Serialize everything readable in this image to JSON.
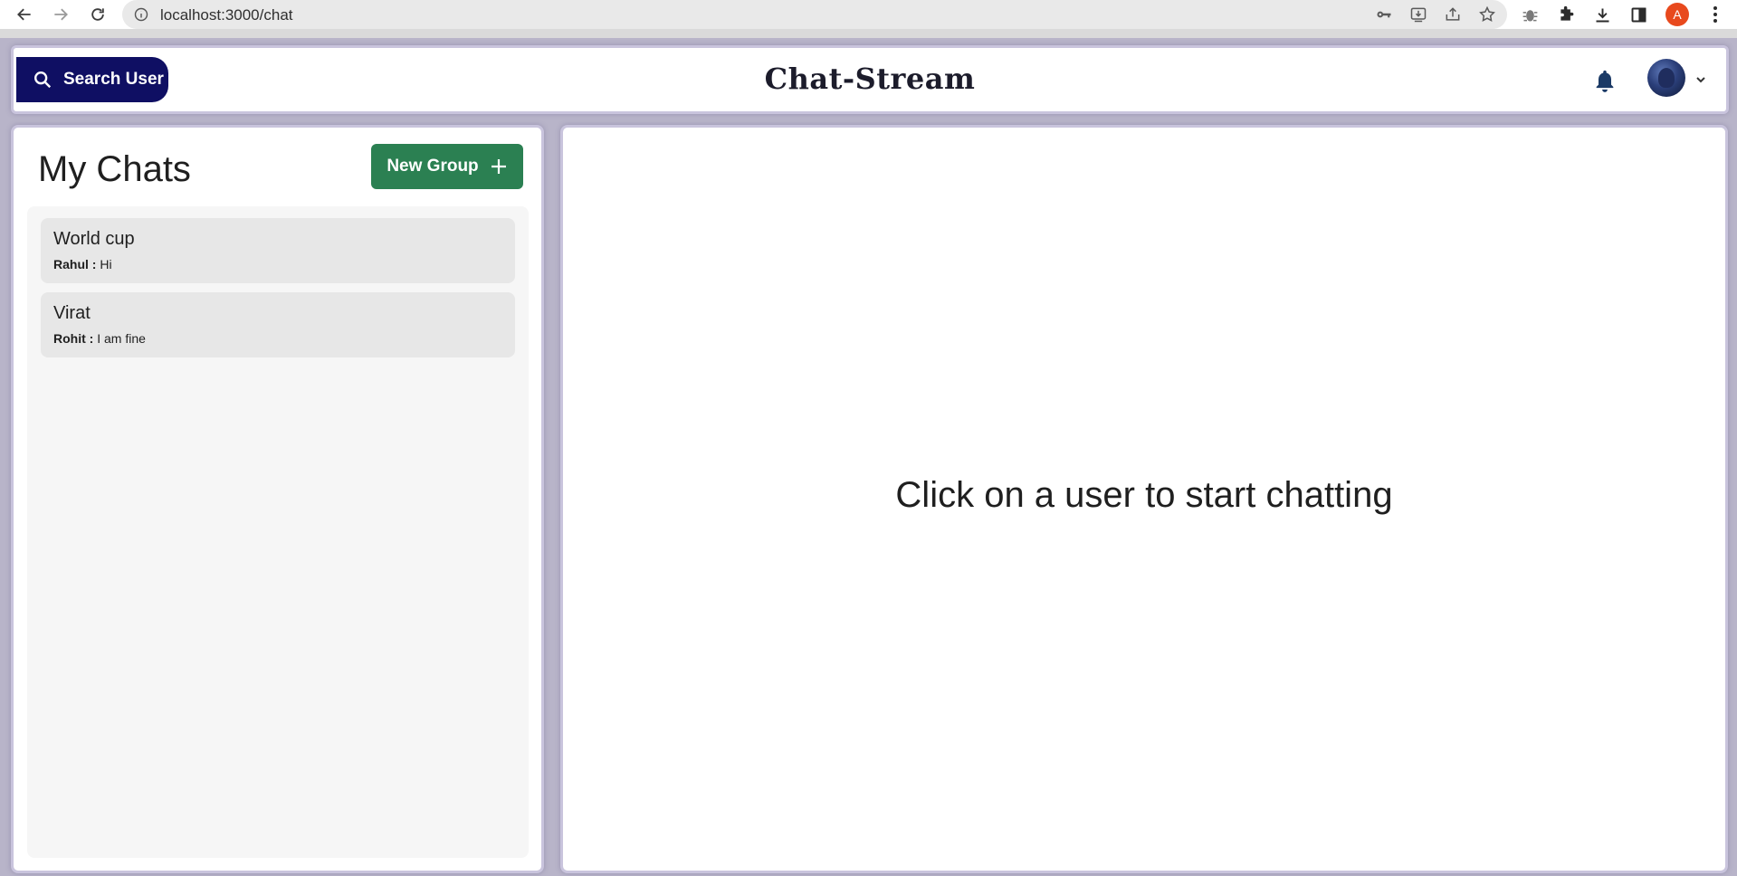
{
  "browser": {
    "url": "localhost:3000/chat",
    "profile_initial": "A"
  },
  "header": {
    "search_label": "Search User",
    "brand": "Chat-Stream"
  },
  "sidebar": {
    "title": "My Chats",
    "new_group_label": "New Group",
    "chats": [
      {
        "name": "World cup",
        "sender": "Rahul :",
        "message": "Hi"
      },
      {
        "name": "Virat",
        "sender": "Rohit :",
        "message": "I am fine"
      }
    ]
  },
  "main": {
    "empty_message": "Click on a user to start chatting"
  },
  "colors": {
    "search_button": "#0f0f63",
    "new_group_button": "#2b8052",
    "background": "#b8b4c9"
  }
}
